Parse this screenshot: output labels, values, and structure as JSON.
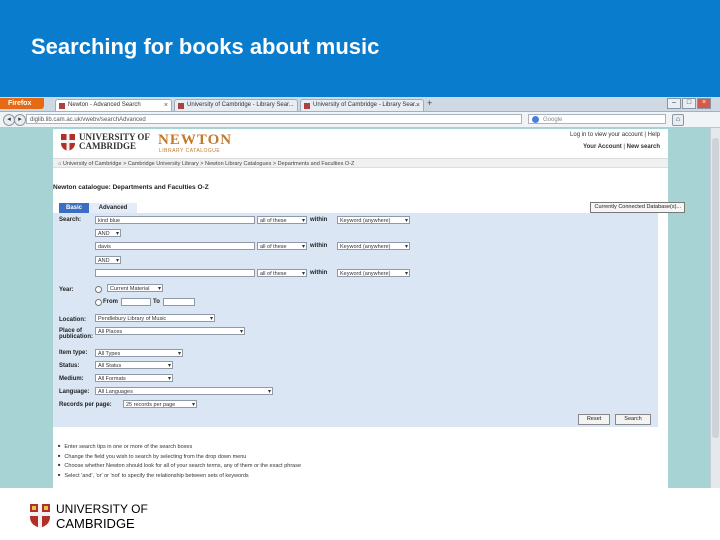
{
  "slide": {
    "title": "Searching for books about music",
    "header_color": "#0a7ccd",
    "footer_logo_line1": "UNIVERSITY OF",
    "footer_logo_line2": "CAMBRIDGE"
  },
  "browser": {
    "firefox_button": "Firefox",
    "tabs": [
      {
        "label": "Newton - Advanced Search",
        "active": true
      },
      {
        "label": "University of Cambridge - Library Sear...",
        "active": false
      },
      {
        "label": "University of Cambridge - Library Sear...",
        "active": false
      }
    ],
    "new_tab": "+",
    "url": "diglib.lib.cam.ac.uk/vwebv/searchAdvanced",
    "search_placeholder": "Google"
  },
  "site": {
    "logo_line1": "UNIVERSITY OF",
    "logo_line2": "CAMBRIDGE",
    "newton": "NEWTON",
    "newton_sub": "LIBRARY CATALOGUE",
    "links": {
      "login": "Log in to view your account",
      "help": "Help",
      "your_account": "Your Account",
      "new_search": "New search"
    },
    "breadcrumb": "University of Cambridge  >  Cambridge University Library  >  Newton Library Catalogues  >  Departments and Faculties O-Z",
    "heading": "Newton catalogue: Departments and Faculties O-Z",
    "connected_db": "Currently Connected Database(s)..."
  },
  "search_tabs": {
    "basic": "Basic",
    "advanced": "Advanced"
  },
  "form": {
    "search_label": "Search:",
    "rows": [
      {
        "term": "kind blue",
        "match": "all of these",
        "within": "within",
        "field": "Keyword (anywhere)"
      },
      {
        "term": "davis",
        "match": "all of these",
        "within": "within",
        "field": "Keyword (anywhere)"
      },
      {
        "term": "",
        "match": "all of these",
        "within": "within",
        "field": "Keyword (anywhere)"
      }
    ],
    "boolean_ops": [
      "AND",
      "AND"
    ],
    "year_label": "Year:",
    "year_option": "Current Material",
    "from_label": "From",
    "to_label": "To",
    "location_label": "Location:",
    "location_value": "Pendlebury Library of Music",
    "place_label_1": "Place of",
    "place_label_2": "publication:",
    "place_value": "All Places",
    "item_type_label": "Item type:",
    "item_type_value": "All Types",
    "status_label": "Status:",
    "status_value": "All Status",
    "medium_label": "Medium:",
    "medium_value": "All Formats",
    "language_label": "Language:",
    "language_value": "All Languages",
    "records_label": "Records per page:",
    "records_value": "25 records per page",
    "reset_button": "Reset",
    "search_button": "Search"
  },
  "tips": [
    "Enter search tips in one or more of the search boxes",
    "Change the field you wish to search by selecting from the drop down menu",
    "Choose whether Newton should look for all of your search terms, any of them or the exact phrase",
    "Select 'and', 'or' or 'not' to specify the relationship between sets of keywords"
  ]
}
